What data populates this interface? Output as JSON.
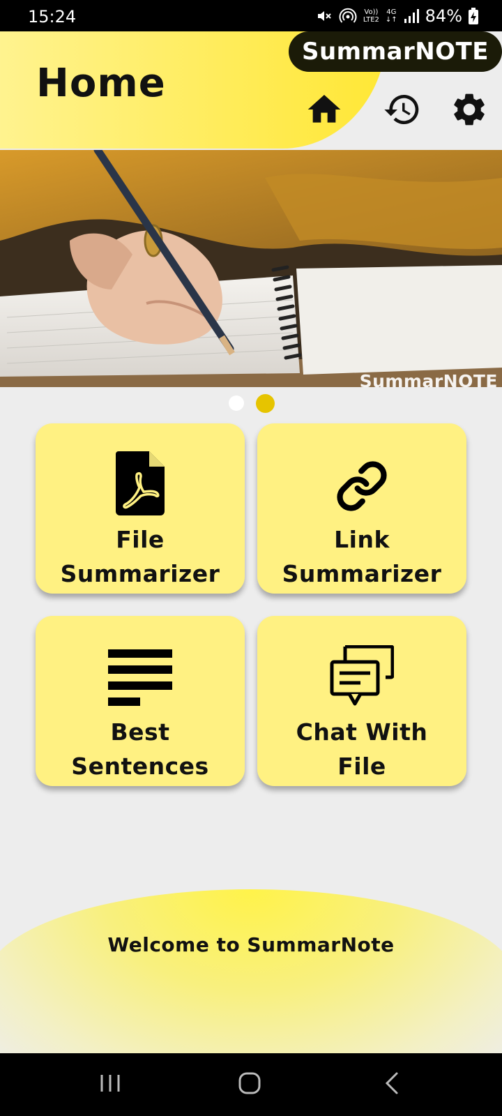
{
  "status_bar": {
    "time": "15:24",
    "battery": "84%",
    "network_top": "Vo))",
    "network_bottom": "LTE2",
    "signal_type": "4G",
    "icons": [
      "mute-icon",
      "hotspot-icon",
      "lte-icon",
      "data-icon",
      "signal-icon",
      "battery-charging-icon"
    ]
  },
  "header": {
    "title": "Home",
    "brand": "SummarNOTE",
    "icons": [
      "home-icon",
      "history-icon",
      "gear-icon"
    ]
  },
  "banner": {
    "watermark": "SummarNOTE",
    "active_slide_index": 1,
    "slide_count": 2
  },
  "cards": [
    {
      "line1": "File",
      "line2": "Summarizer",
      "icon": "pdf-file-icon"
    },
    {
      "line1": "Link",
      "line2": "Summarizer",
      "icon": "link-icon"
    },
    {
      "line1": "Best",
      "line2": "Sentences",
      "icon": "text-lines-icon"
    },
    {
      "line1": "Chat With",
      "line2": "File",
      "icon": "chat-icon"
    }
  ],
  "welcome": {
    "text": "Welcome to SummarNote"
  },
  "nav_bar": {
    "icons": [
      "recent-apps-icon",
      "home-circle-icon",
      "back-icon"
    ]
  },
  "colors": {
    "accent_yellow": "#ffe735",
    "card_yellow": "#fff182",
    "dot_active": "#e6c400",
    "brand_pill": "#1b1b08",
    "background": "#ededed"
  }
}
